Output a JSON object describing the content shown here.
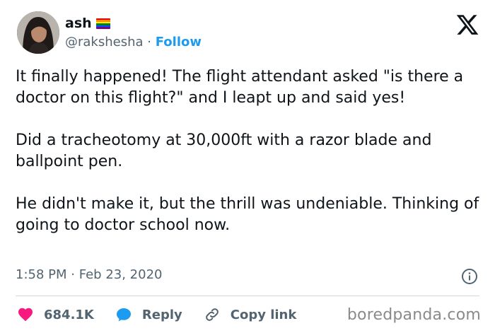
{
  "user": {
    "display_name": "ash",
    "handle": "@rakshesha",
    "separator": "·",
    "follow_label": "Follow",
    "flag_colors": [
      "#e40303",
      "#ff8c00",
      "#ffed00",
      "#008026",
      "#004dff",
      "#750787"
    ]
  },
  "tweet": {
    "paragraphs": [
      "It finally happened! The flight attendant asked \"is there a doctor on this flight?\" and I leapt up and said yes!",
      "Did a tracheotomy at 30,000ft with a razor blade and ballpoint pen.",
      "He didn't make it, but the thrill was undeniable. Thinking of going to doctor school now."
    ],
    "time": "1:58 PM",
    "meta_separator": "·",
    "date": "Feb 23, 2020"
  },
  "actions": {
    "likes": "684.1K",
    "reply_label": "Reply",
    "copy_link_label": "Copy link"
  },
  "watermark": "boredpanda.com",
  "icons": {
    "platform_logo": "x-logo-icon",
    "like": "heart-icon",
    "reply": "speech-bubble-icon",
    "copy": "link-icon",
    "info": "info-icon"
  },
  "colors": {
    "accent": "#1d9bf0",
    "heart": "#f91880",
    "secondary_text": "#536471"
  }
}
